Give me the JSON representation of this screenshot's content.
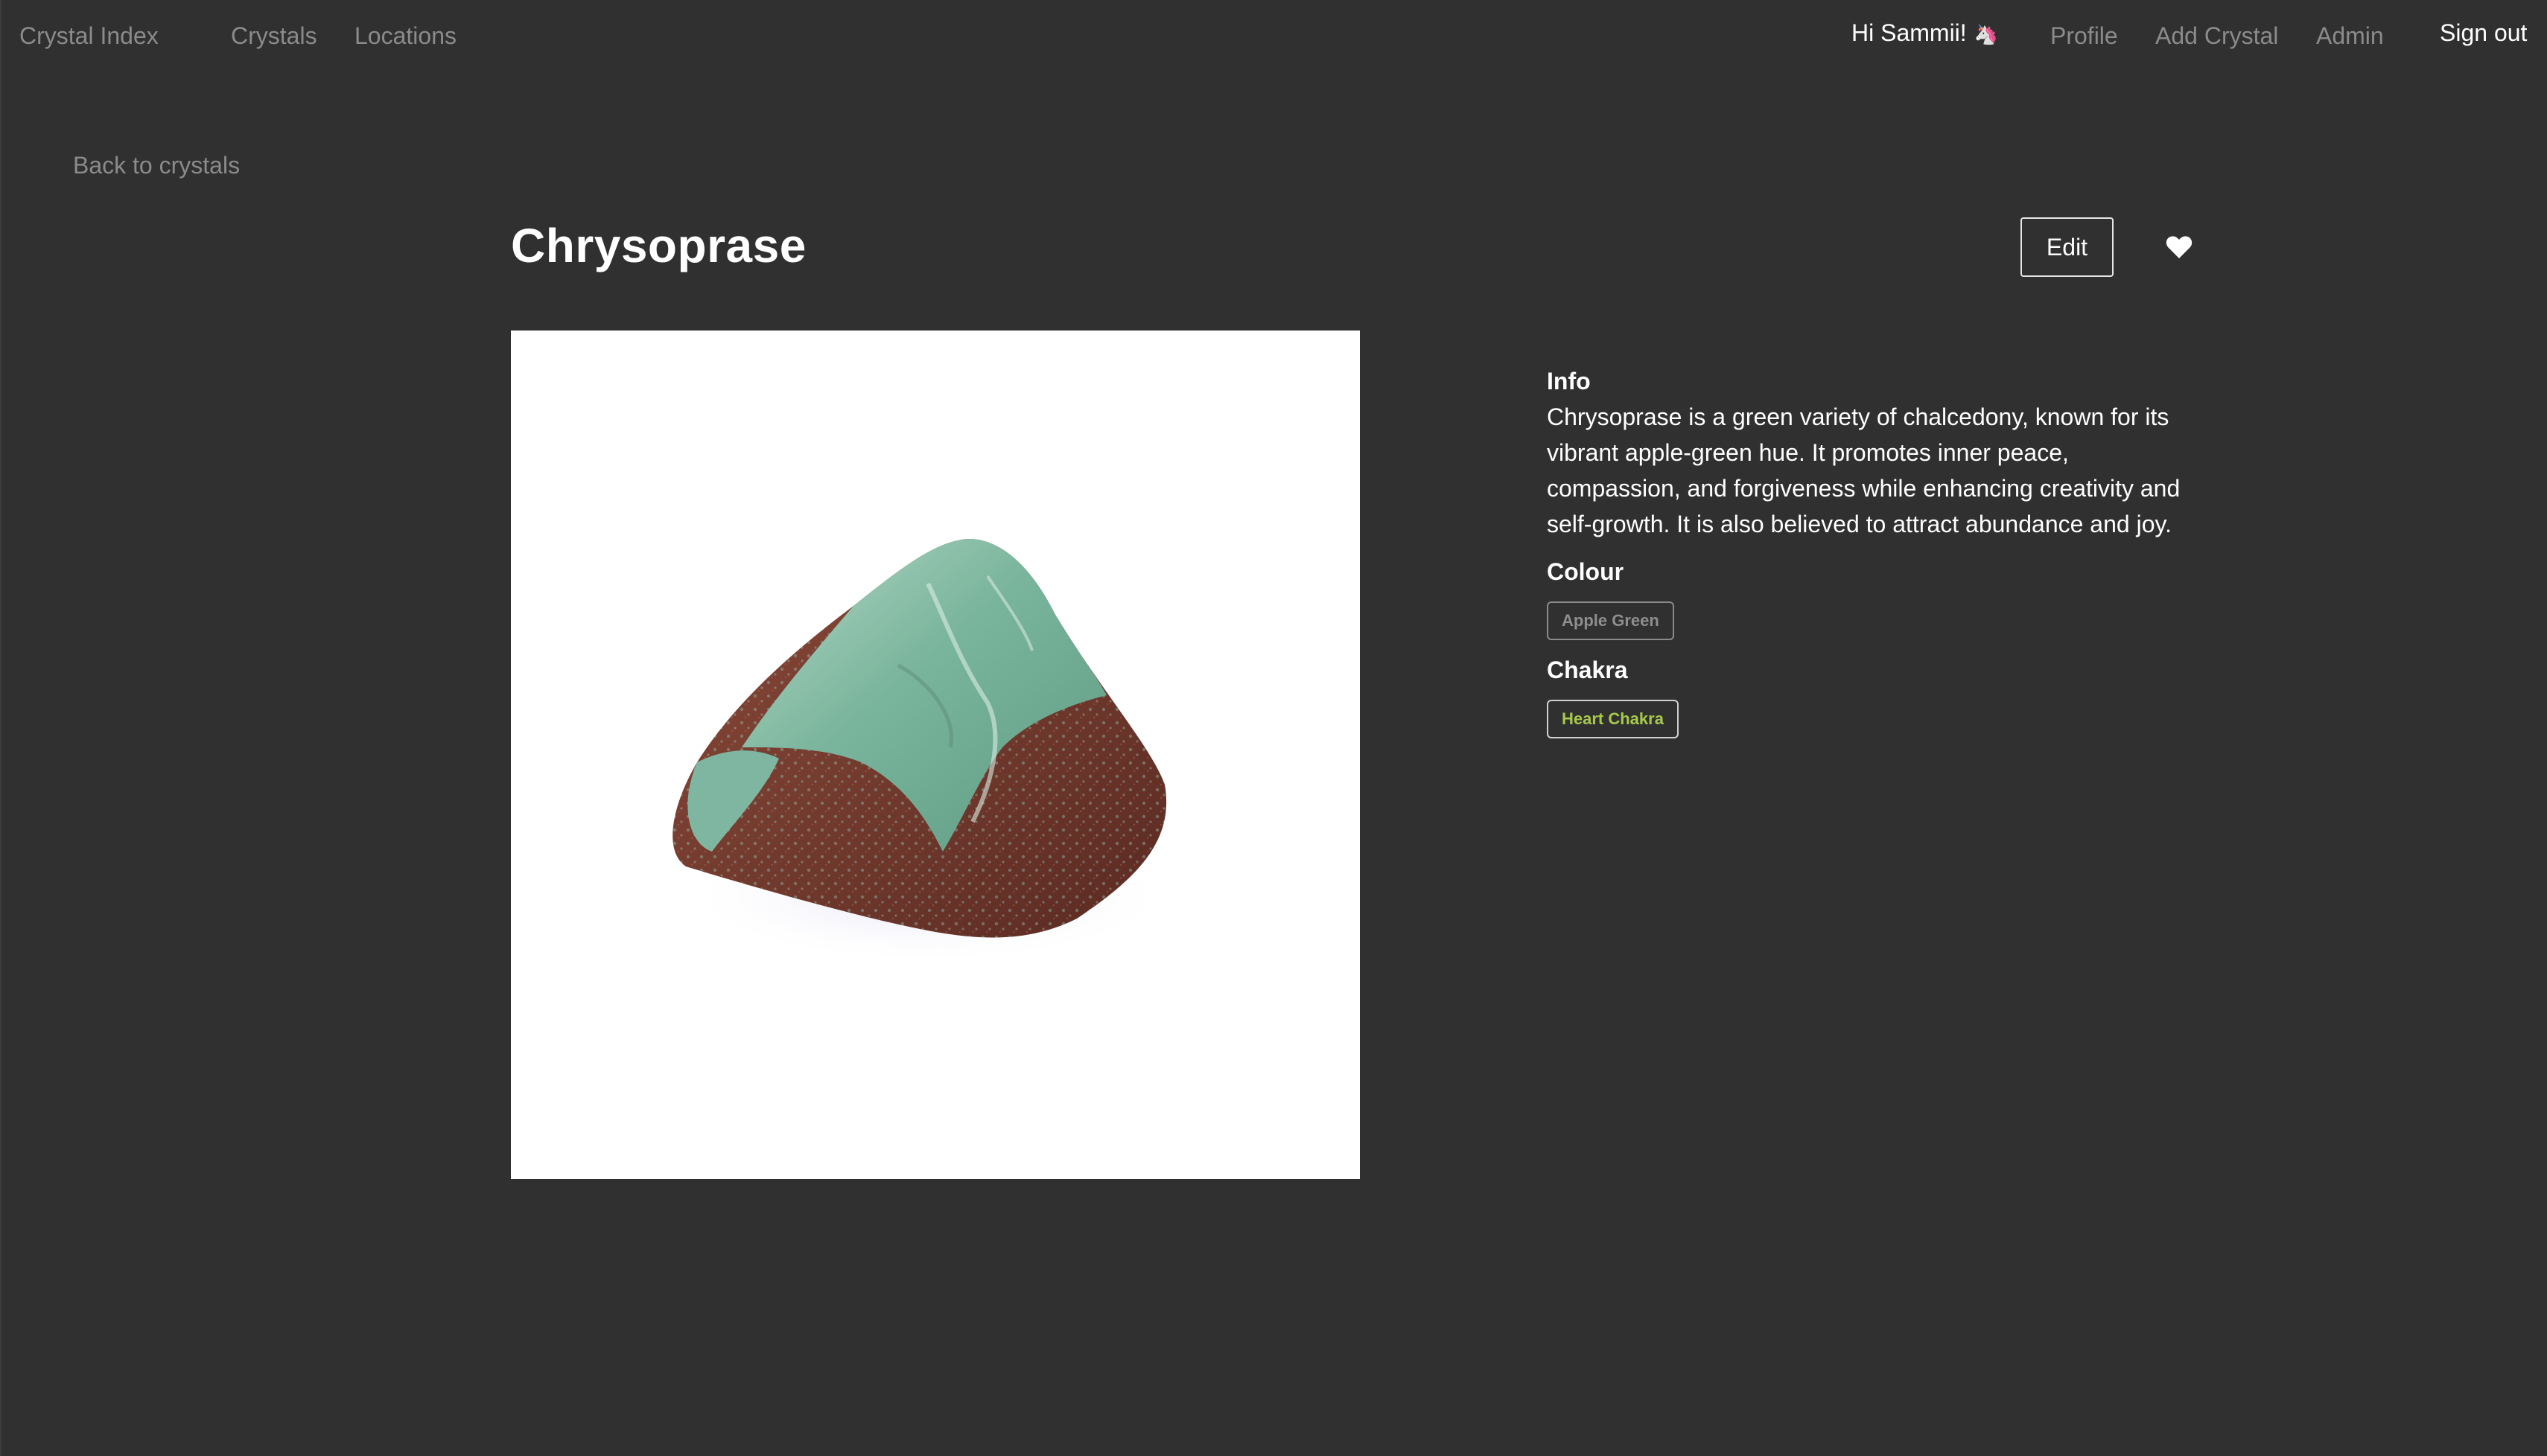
{
  "nav": {
    "brand": "Crystal Index",
    "links": [
      "Crystals",
      "Locations"
    ],
    "greeting": "Hi Sammii!",
    "greeting_emoji": "🦄",
    "right_links": [
      "Profile",
      "Add Crystal",
      "Admin"
    ],
    "sign_out": "Sign out"
  },
  "back_link": "Back to crystals",
  "crystal": {
    "name": "Chrysoprase",
    "edit_label": "Edit",
    "favourite_icon": "heart-icon",
    "info_heading": "Info",
    "info_text": "Chrysoprase is a green variety of chalcedony, known for its vibrant apple-green hue. It promotes inner peace, compassion, and forgiveness while enhancing creativity and self-growth. It is also believed to attract abundance and joy.",
    "colour_heading": "Colour",
    "colour_tag": "Apple Green",
    "chakra_heading": "Chakra",
    "chakra_tag": "Heart Chakra"
  },
  "colors": {
    "background": "#303030",
    "muted_text": "#8b8b8b",
    "chakra_tag_text": "#a7c94b"
  }
}
